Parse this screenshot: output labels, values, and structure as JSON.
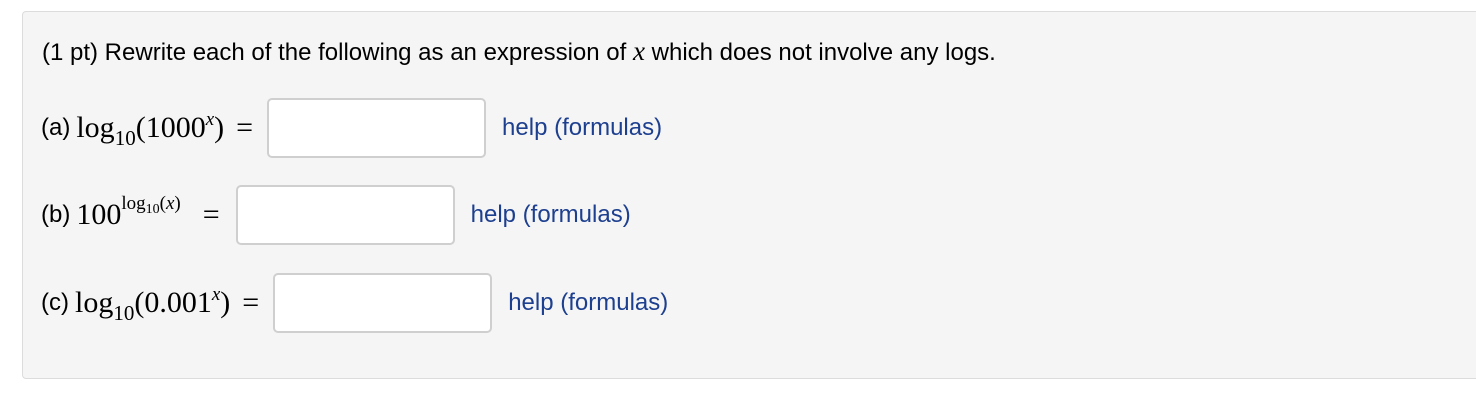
{
  "problem": {
    "statement_before": "(1 pt) Rewrite each of the following as an expression of ",
    "statement_var": "x",
    "statement_after": " which does not involve any logs."
  },
  "parts": [
    {
      "label": "(a)",
      "func": "log",
      "base": "10",
      "open": "(",
      "number": "1000",
      "exponent": "x",
      "close": ")",
      "equals": "=",
      "input_value": "",
      "help_label": "help (formulas)"
    },
    {
      "label": "(b)",
      "number": "100",
      "exp_func": "log",
      "exp_base": "10",
      "exp_arg_open": "(",
      "exp_arg": "x",
      "exp_arg_close": ")",
      "equals": "=",
      "input_value": "",
      "help_label": "help (formulas)"
    },
    {
      "label": "(c)",
      "func": "log",
      "base": "10",
      "open": "(",
      "number": "0.001",
      "exponent": "x",
      "close": ")",
      "equals": "=",
      "input_value": "",
      "help_label": "help (formulas)"
    }
  ],
  "colors": {
    "panel_bg": "#f5f5f5",
    "link": "#1d3f8f"
  }
}
